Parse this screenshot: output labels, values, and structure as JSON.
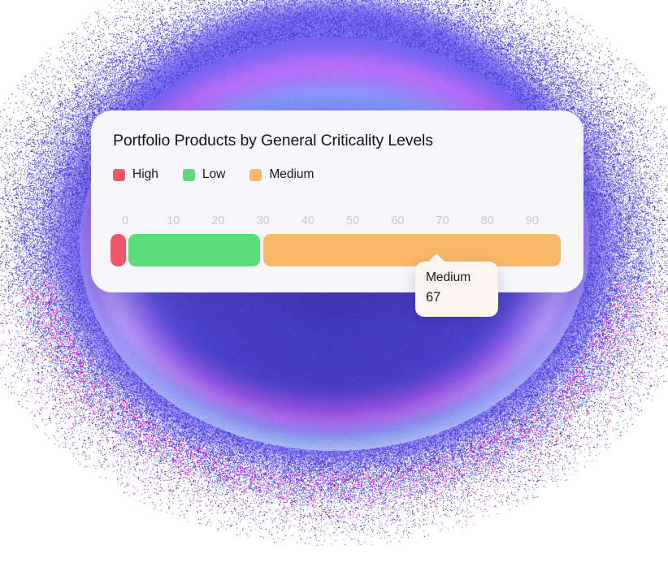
{
  "background": {
    "name": "grainy-purple-blob",
    "base_color": "#6C63F0",
    "deep_color": "#3E3496",
    "highlight_color": "#9684FF",
    "fringe_magenta": "#FF14BE",
    "fringe_cyan": "#00E6FF",
    "page_color": "#FFFFFF"
  },
  "card": {
    "background": "#F7F6FB",
    "title": "Portfolio Products by General Criticality Levels"
  },
  "legend": {
    "items": [
      {
        "label": "High",
        "color": "#F2566A"
      },
      {
        "label": "Low",
        "color": "#5BDE79"
      },
      {
        "label": "Medium",
        "color": "#F7B86A"
      }
    ]
  },
  "tooltip": {
    "series": "Medium",
    "value": "67",
    "background": "#FBF5EF"
  },
  "chart_data": {
    "type": "bar",
    "orientation": "horizontal",
    "stacked": true,
    "title": "Portfolio Products by General Criticality Levels",
    "xlabel": "",
    "ylabel": "",
    "categories": [
      "Portfolio Products"
    ],
    "series": [
      {
        "name": "High",
        "values": [
          4
        ],
        "color": "#F2566A"
      },
      {
        "name": "Low",
        "values": [
          30
        ],
        "color": "#5BDE79"
      },
      {
        "name": "Medium",
        "values": [
          67
        ],
        "color": "#F7B86A"
      }
    ],
    "total": 101,
    "xlim": [
      0,
      100
    ],
    "tick_step": 10,
    "tick_labels": [
      "0",
      "10",
      "20",
      "30",
      "40",
      "50",
      "60",
      "70",
      "80",
      "90"
    ],
    "grid": false,
    "legend_position": "top",
    "annotations": [
      {
        "type": "tooltip",
        "series": "Medium",
        "value": 67,
        "x": 72
      }
    ]
  }
}
